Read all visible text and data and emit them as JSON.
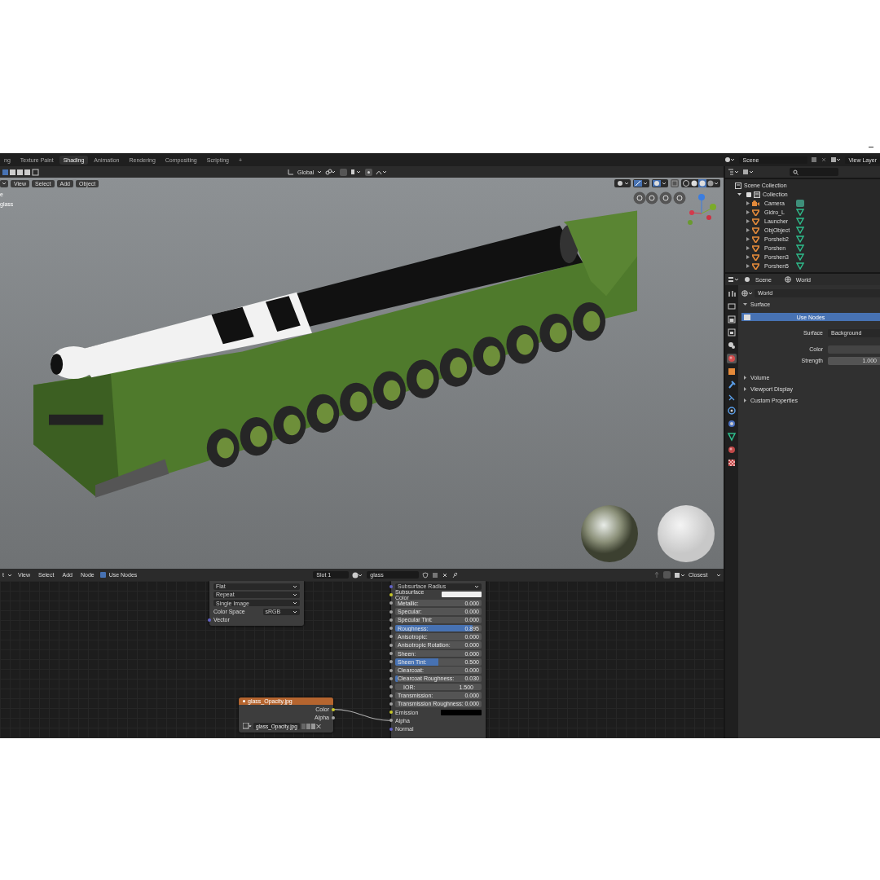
{
  "workspace_tabs": [
    {
      "label": "ng",
      "selected": false
    },
    {
      "label": "Texture Paint",
      "selected": false
    },
    {
      "label": "Shading",
      "selected": true
    },
    {
      "label": "Animation",
      "selected": false
    },
    {
      "label": "Rendering",
      "selected": false
    },
    {
      "label": "Compositing",
      "selected": false
    },
    {
      "label": "Scripting",
      "selected": false
    }
  ],
  "add_workspace": "+",
  "scene": "Scene",
  "view_layer": "View Layer",
  "viewport": {
    "orientation": "Global",
    "menus": [
      "View",
      "Select",
      "Add",
      "Object"
    ],
    "overlay_lines": [
      "e",
      "glass"
    ]
  },
  "outliner": {
    "title": "Scene Collection",
    "collections": [
      {
        "label": "Collection",
        "checked": true,
        "expanded": true,
        "children": [
          {
            "label": "Camera",
            "kind": "camera"
          },
          {
            "label": "Gidro_L",
            "kind": "mesh"
          },
          {
            "label": "Launcher",
            "kind": "mesh"
          },
          {
            "label": "ObjObject",
            "kind": "mesh"
          },
          {
            "label": "Porsheb2",
            "kind": "mesh"
          },
          {
            "label": "Porshen",
            "kind": "mesh"
          },
          {
            "label": "Porshen3",
            "kind": "mesh"
          },
          {
            "label": "Porshen5",
            "kind": "mesh"
          }
        ]
      }
    ]
  },
  "properties": {
    "breadcrumb": [
      "Scene",
      "World"
    ],
    "world": "World",
    "tabs": [
      {
        "kind": "tool",
        "selected": false
      },
      {
        "kind": "render",
        "selected": false
      },
      {
        "kind": "output",
        "selected": false
      },
      {
        "kind": "view_layer",
        "selected": false
      },
      {
        "kind": "scene",
        "selected": false
      },
      {
        "kind": "world",
        "selected": true
      },
      {
        "kind": "object",
        "selected": false
      },
      {
        "kind": "modifier",
        "selected": false
      },
      {
        "kind": "particles",
        "selected": false
      },
      {
        "kind": "physics",
        "selected": false
      },
      {
        "kind": "constraints",
        "selected": false
      },
      {
        "kind": "data",
        "selected": false
      },
      {
        "kind": "material",
        "selected": false
      },
      {
        "kind": "texture",
        "selected": false
      }
    ],
    "panels": [
      {
        "label": "Surface",
        "expanded": true,
        "use_nodes": "Use Nodes",
        "fields": [
          {
            "kind": "dropdown",
            "label": "Surface",
            "value": "Background"
          },
          {
            "kind": "color",
            "label": "Color",
            "color": "#444444"
          },
          {
            "kind": "number",
            "label": "Strength",
            "value": "1.000"
          }
        ]
      },
      {
        "label": "Volume",
        "expanded": false
      },
      {
        "label": "Viewport Display",
        "expanded": false
      },
      {
        "label": "Custom Properties",
        "expanded": false
      }
    ]
  },
  "node_editor": {
    "editor": "t",
    "menus": [
      "View",
      "Select",
      "Add",
      "Node"
    ],
    "use_nodes": {
      "label": "Use Nodes",
      "checked": true
    },
    "slot": "Slot 1",
    "material": "glass",
    "interpolation": "Closest",
    "image_node": {
      "rows": [
        {
          "kind": "dropdown",
          "label": "Flat"
        },
        {
          "kind": "dropdown",
          "label": "Repeat"
        },
        {
          "kind": "dropdown",
          "label": "Single Image"
        },
        {
          "kind": "labeled_dropdown",
          "label": "Color Space",
          "value": "sRGB"
        },
        {
          "kind": "input",
          "label": "Vector",
          "socket": {
            "color": "#6363c7"
          }
        }
      ]
    },
    "bsdf_node": {
      "rows": [
        {
          "kind": "dropdown",
          "label": "Subsurface Radius",
          "socket": {
            "color": "#6363c7"
          }
        },
        {
          "kind": "color",
          "label": "Subsurface Color",
          "socket": {
            "color": "#c7c729"
          },
          "swatch": {
            "color": "#f0f0f0"
          }
        },
        {
          "kind": "slider",
          "label": "Metallic:",
          "value": "0.000",
          "level": 0,
          "socket": {
            "color": "#a1a1a1"
          }
        },
        {
          "kind": "slider",
          "label": "Specular:",
          "value": "0.000",
          "level": 0,
          "socket": {
            "color": "#a1a1a1"
          }
        },
        {
          "kind": "slider",
          "label": "Specular Tint:",
          "value": "0.000",
          "level": 0,
          "socket": {
            "color": "#a1a1a1"
          }
        },
        {
          "kind": "slider",
          "label": "Roughness:",
          "value": "0.895",
          "level": 0.895,
          "socket": {
            "color": "#a1a1a1"
          }
        },
        {
          "kind": "slider",
          "label": "Anisotropic:",
          "value": "0.000",
          "level": 0,
          "socket": {
            "color": "#a1a1a1"
          }
        },
        {
          "kind": "slider",
          "label": "Anisotropic Rotation:",
          "value": "0.000",
          "level": 0,
          "socket": {
            "color": "#a1a1a1"
          }
        },
        {
          "kind": "slider",
          "label": "Sheen:",
          "value": "0.000",
          "level": 0,
          "socket": {
            "color": "#a1a1a1"
          }
        },
        {
          "kind": "slider",
          "label": "Sheen Tint:",
          "value": "0.500",
          "level": 0.5,
          "socket": {
            "color": "#a1a1a1"
          }
        },
        {
          "kind": "slider",
          "label": "Clearcoat:",
          "value": "0.000",
          "level": 0,
          "socket": {
            "color": "#a1a1a1"
          }
        },
        {
          "kind": "slider",
          "label": "Clearcoat Roughness:",
          "value": "0.030",
          "level": 0.03,
          "socket": {
            "color": "#a1a1a1"
          }
        },
        {
          "kind": "number",
          "label": "IOR:",
          "value": "1.500",
          "socket": {
            "color": "#a1a1a1"
          }
        },
        {
          "kind": "slider",
          "label": "Transmission:",
          "value": "0.000",
          "level": 0,
          "socket": {
            "color": "#a1a1a1"
          }
        },
        {
          "kind": "slider",
          "label": "Transmission Roughness:",
          "value": "0.000",
          "level": 0,
          "socket": {
            "color": "#a1a1a1"
          }
        },
        {
          "kind": "color",
          "label": "Emission",
          "socket": {
            "color": "#c7c729"
          },
          "swatch": {
            "color": "#000000"
          }
        },
        {
          "kind": "input",
          "label": "Alpha",
          "socket": {
            "color": "#a1a1a1"
          }
        },
        {
          "kind": "input",
          "label": "Normal",
          "socket": {
            "color": "#6363c7"
          }
        }
      ]
    },
    "texture_node": {
      "title": "glass_Opacity.jpg",
      "outputs": [
        {
          "label": "Color",
          "socket": {
            "color": "#c7c729"
          }
        },
        {
          "label": "Alpha",
          "socket": {
            "color": "#a1a1a1"
          }
        }
      ],
      "image": "glass_Opacity.jpg"
    }
  }
}
